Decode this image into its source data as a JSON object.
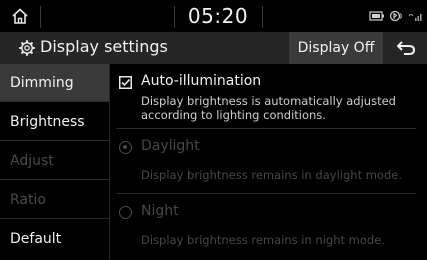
{
  "status_bar": {
    "time": "05:20",
    "icons": [
      "home-icon",
      "battery-icon",
      "bluetooth-audio-icon",
      "signal-icon"
    ]
  },
  "title_bar": {
    "title": "Display settings",
    "display_off_label": "Display Off",
    "icons": [
      "gear-icon",
      "back-icon"
    ]
  },
  "sidebar": {
    "items": [
      {
        "label": "Dimming",
        "state": "selected"
      },
      {
        "label": "Brightness",
        "state": "enabled"
      },
      {
        "label": "Adjust",
        "state": "disabled"
      },
      {
        "label": "Ratio",
        "state": "disabled"
      },
      {
        "label": "Default",
        "state": "enabled"
      }
    ]
  },
  "options": {
    "auto_illumination": {
      "label": "Auto-illumination",
      "checked": true,
      "desc_line1": "Display brightness is automatically adjusted",
      "desc_line2": "according to lighting conditions."
    },
    "daylight": {
      "label": "Daylight",
      "selected": true,
      "enabled": false,
      "desc": "Display brightness remains in daylight mode."
    },
    "night": {
      "label": "Night",
      "selected": false,
      "enabled": false,
      "desc": "Display brightness remains in night mode."
    }
  },
  "colors": {
    "background": "#000000",
    "title_bar": "#262626",
    "selected": "#3a3a3a",
    "text": "#f2f2f2",
    "disabled": "#474747"
  }
}
